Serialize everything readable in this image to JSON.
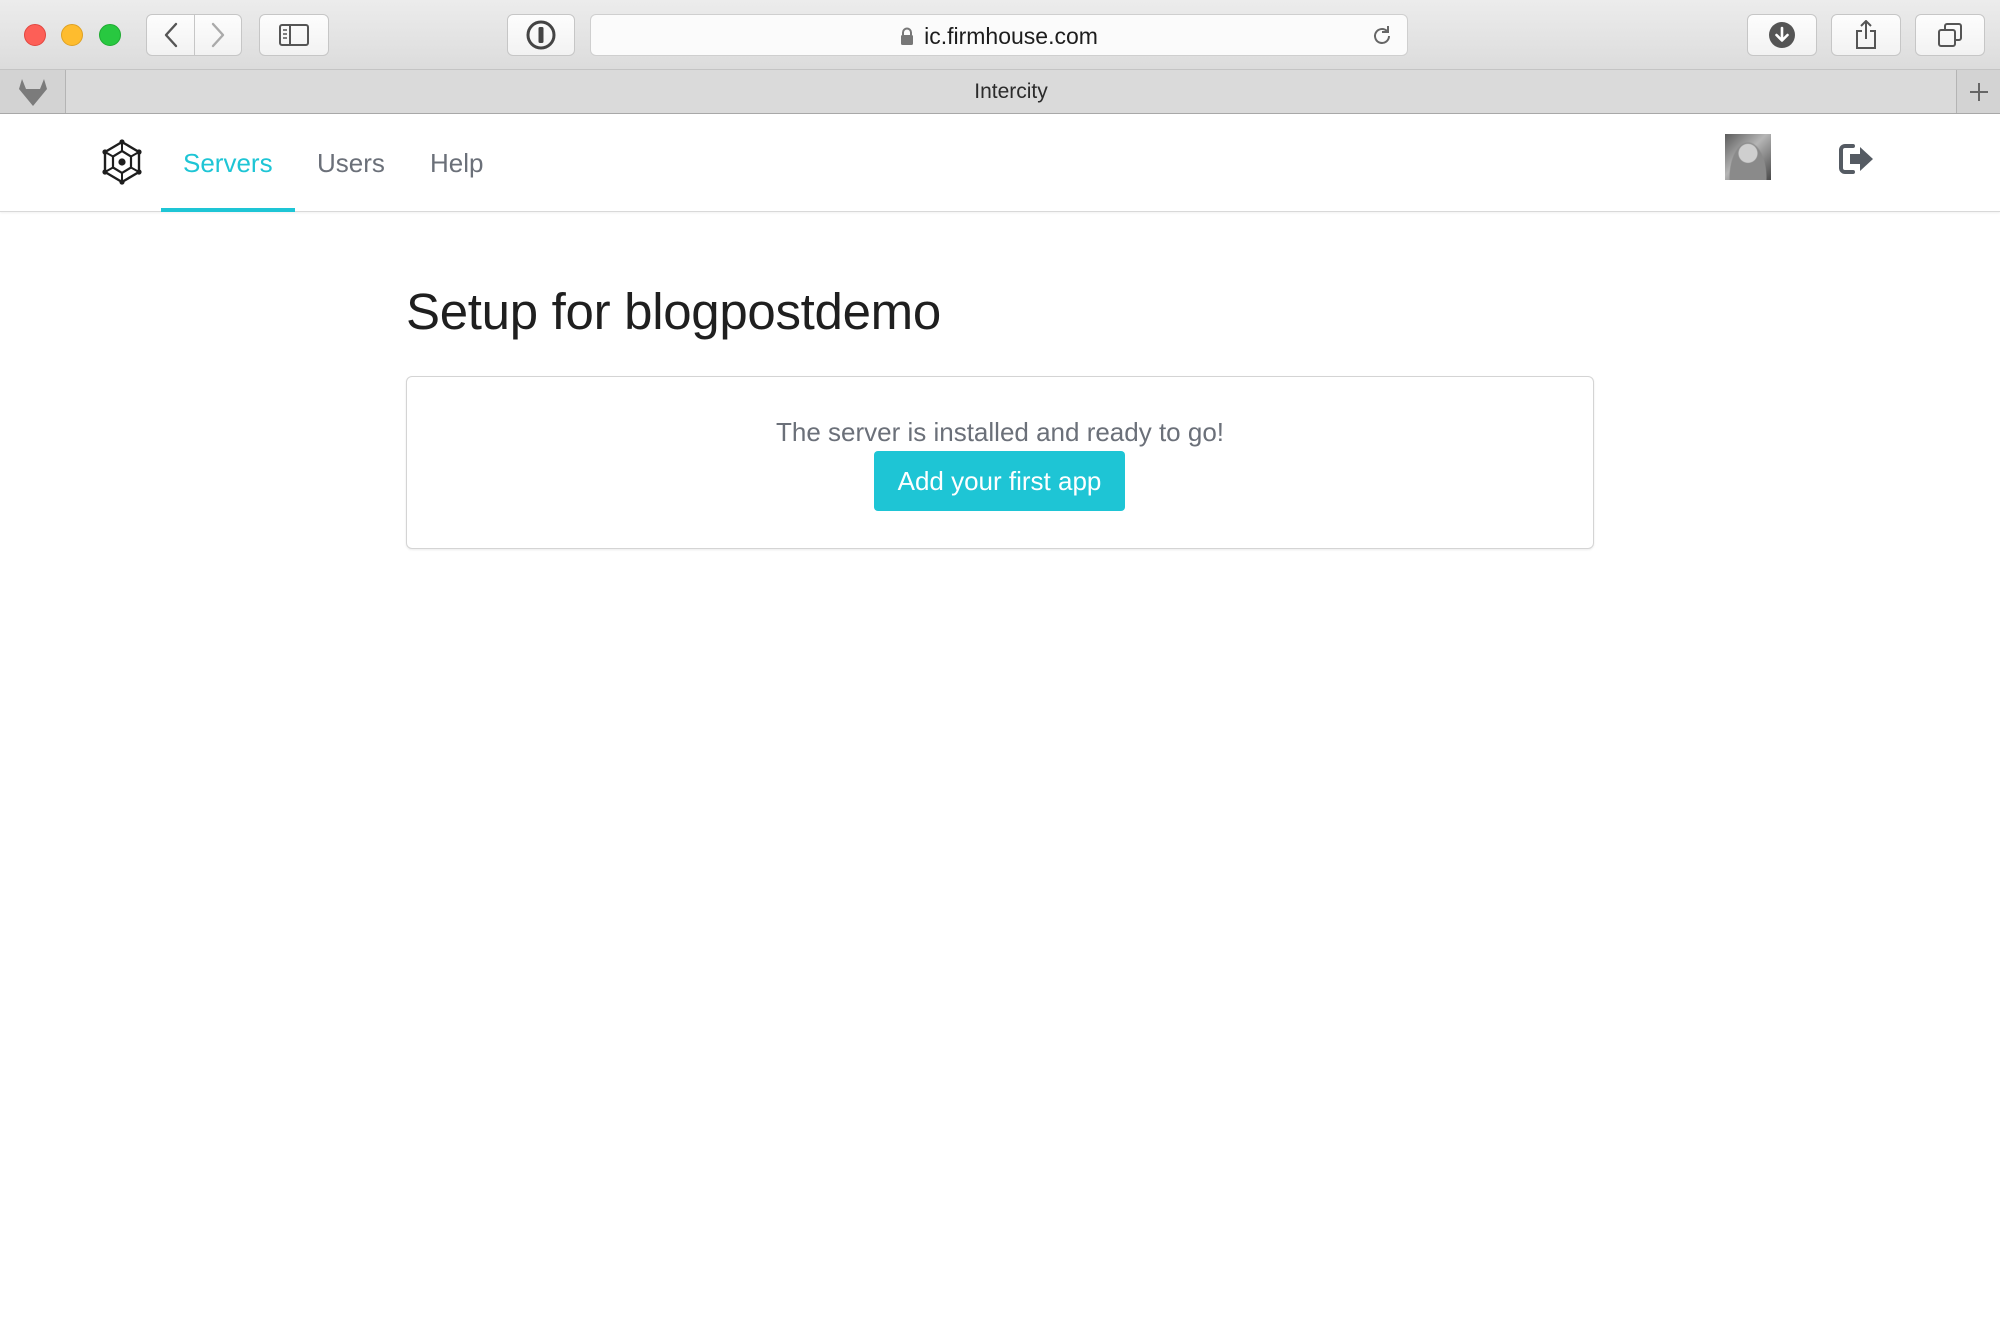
{
  "browser": {
    "url": "ic.firmhouse.com",
    "tab_title": "Intercity"
  },
  "nav": {
    "items": [
      {
        "label": "Servers",
        "active": true
      },
      {
        "label": "Users",
        "active": false
      },
      {
        "label": "Help",
        "active": false
      }
    ]
  },
  "main": {
    "title": "Setup for blogpostdemo",
    "message": "The server is installed and ready to go!",
    "cta_label": "Add your first app"
  },
  "theme": {
    "accent": "#1ec5d5",
    "nav_text": "#6b7079"
  },
  "icons": {
    "brand": "hexagon-network-logo-icon",
    "logout": "sign-out-icon",
    "pinned_tab": "gitlab-fox-icon"
  }
}
